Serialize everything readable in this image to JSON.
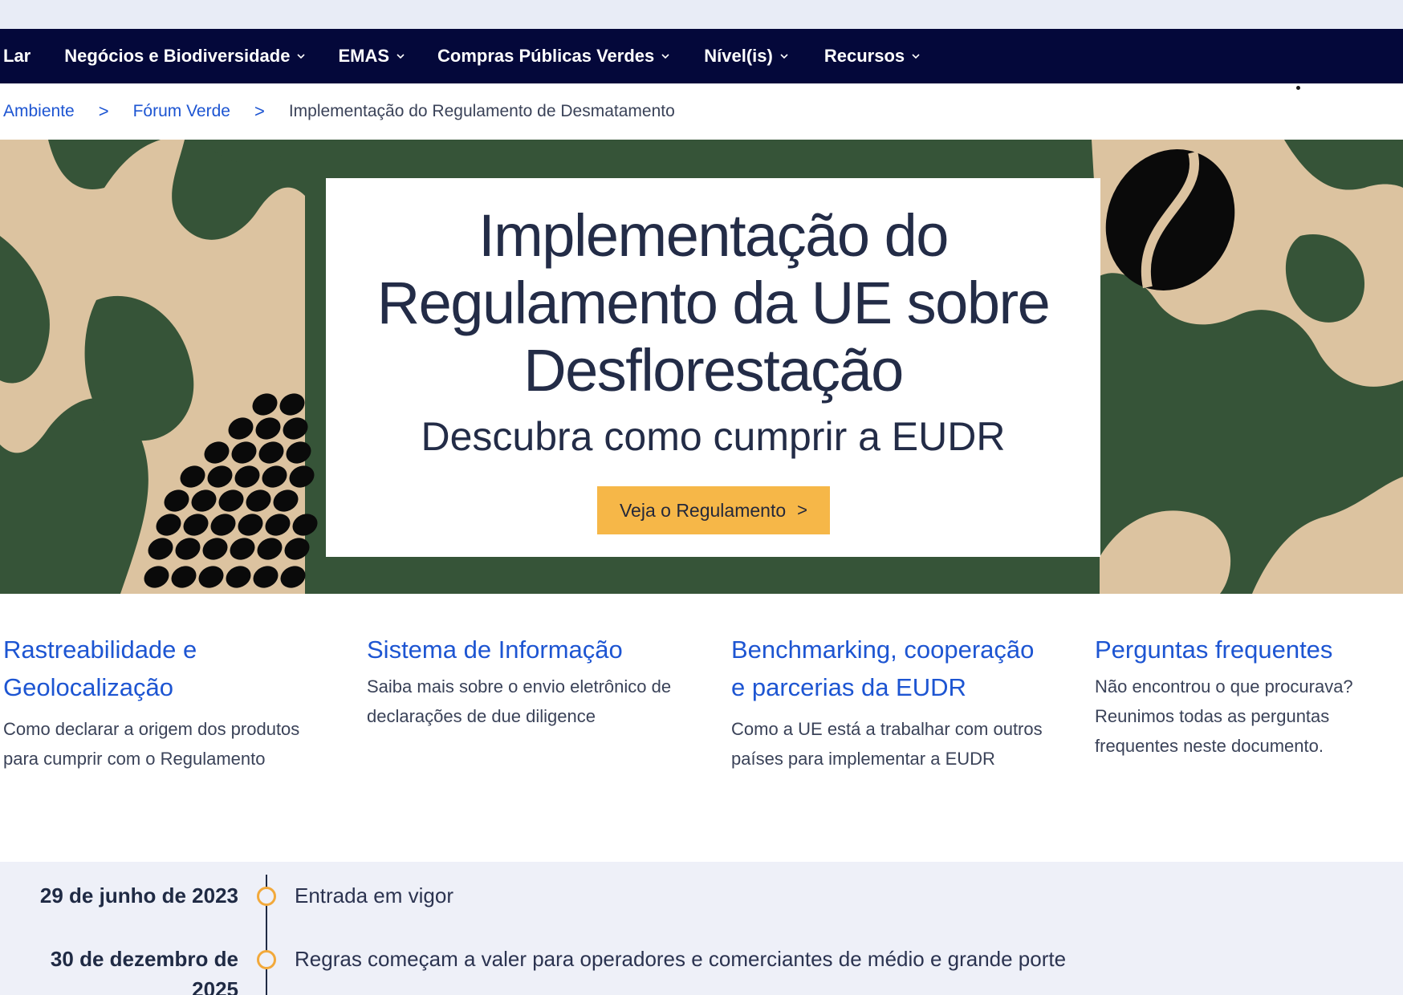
{
  "nav": {
    "items": [
      {
        "label": "Lar",
        "dropdown": false
      },
      {
        "label": "Negócios e Biodiversidade",
        "dropdown": true
      },
      {
        "label": "EMAS",
        "dropdown": true
      },
      {
        "label": "Compras Públicas Verdes",
        "dropdown": true
      },
      {
        "label": "Nível(is)",
        "dropdown": true
      },
      {
        "label": "Recursos",
        "dropdown": true
      }
    ]
  },
  "breadcrumb": {
    "items": [
      "Ambiente",
      "Fórum Verde"
    ],
    "current": "Implementação do Regulamento de Desmatamento"
  },
  "hero": {
    "title": "Implementação do Regulamento da UE sobre Desflorestação",
    "subtitle": "Descubra como cumprir a EUDR",
    "button_label": "Veja o Regulamento",
    "colors": {
      "green": "#365438",
      "beige": "#dcc3a0",
      "bean": "#0a0a0a",
      "button": "#f6b748"
    }
  },
  "cards": [
    {
      "title": "Rastreabilidade e Geolocalização",
      "description": "Como declarar a origem dos produtos para cumprir com o Regulamento"
    },
    {
      "title": "Sistema de Informação",
      "description": "Saiba mais sobre o envio eletrônico de declarações de due diligence"
    },
    {
      "title": "Benchmarking, cooperação e parcerias da EUDR",
      "description": "Como a UE está a trabalhar com outros países para implementar a EUDR"
    },
    {
      "title": "Perguntas frequentes",
      "description": "Não encontrou o que procurava? Reunimos todas as perguntas frequentes neste documento."
    }
  ],
  "timeline": [
    {
      "date": "29 de junho de 2023",
      "text": "Entrada em vigor"
    },
    {
      "date": "30 de dezembro de 2025",
      "text": "Regras começam a valer para operadores e comerciantes de médio e grande porte"
    }
  ],
  "colors": {
    "nav_bg": "#04083a",
    "link": "#1d55d2",
    "timeline_marker": "#f2a93b"
  }
}
